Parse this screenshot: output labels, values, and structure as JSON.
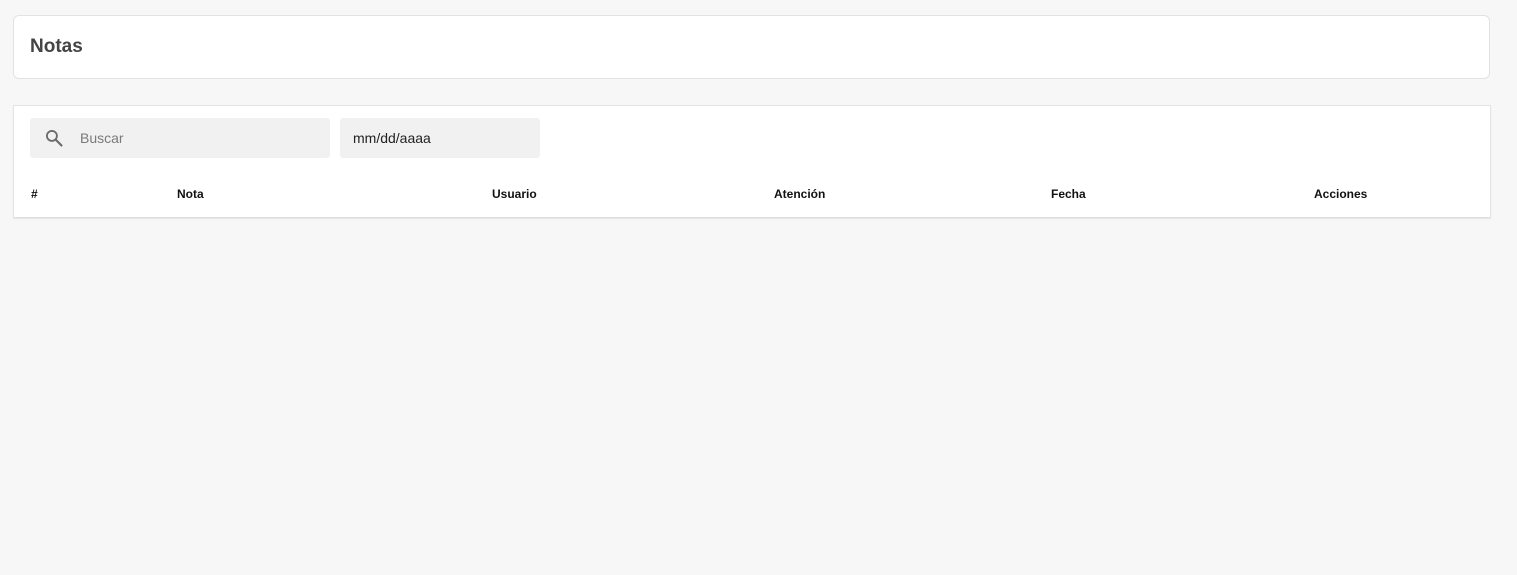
{
  "header": {
    "title": "Notas"
  },
  "filters": {
    "search_placeholder": "Buscar",
    "date_placeholder": "mm/dd/aaaa"
  },
  "table": {
    "columns": [
      "#",
      "Nota",
      "Usuario",
      "Atención",
      "Fecha",
      "Acciones"
    ],
    "rows": []
  },
  "icons": {
    "search": "search-icon"
  },
  "colors": {
    "background": "#f7f7f7",
    "card": "#ffffff",
    "input_bg": "#f1f1f1",
    "title": "#444444"
  }
}
